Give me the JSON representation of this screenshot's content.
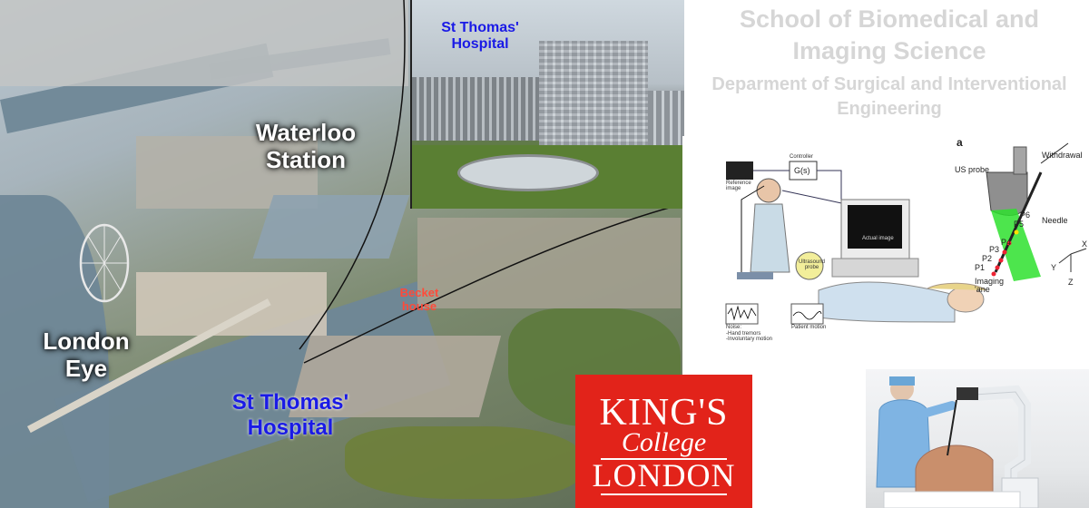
{
  "aerial": {
    "label_waterloo": "Waterloo\nStation",
    "label_london_eye": "London\nEye",
    "label_st_thomas": "St Thomas'\nHospital",
    "label_becket": "Becket\nhouse"
  },
  "inset": {
    "label_hospital": "St Thomas'\nHospital"
  },
  "titles": {
    "school": "School of Biomedical and Imaging Science",
    "department": "Deparment of Surgical and Interventional Engineering"
  },
  "diagram": {
    "panel_letter": "a",
    "us_probe": "US probe",
    "withdrawal": "Withdrawal",
    "needle": "Needle",
    "imaging_plane": "Imaging\n'ane",
    "points": [
      "P1",
      "P2",
      "P3",
      "P4",
      "P5",
      "P6"
    ],
    "axes": [
      "X",
      "Y",
      "Z"
    ],
    "reference_image": "Reference\nimage",
    "controller": "Controller",
    "controller_fn": "G(s)",
    "actual_image": "Actual image",
    "ultrasound_probe": "Ultrasound\nprobe",
    "patient_motion": "Patient motion",
    "noise": "Noise:\n-Hand tremors\n-Involuntary motion"
  },
  "logo": {
    "kings": "KING'S",
    "college": "College",
    "london": "LONDON"
  },
  "colors": {
    "kcl_red": "#e2231a",
    "label_blue": "#1a1ae6",
    "title_grey": "#d6d6d6",
    "becket_red": "#ff4a3a"
  }
}
